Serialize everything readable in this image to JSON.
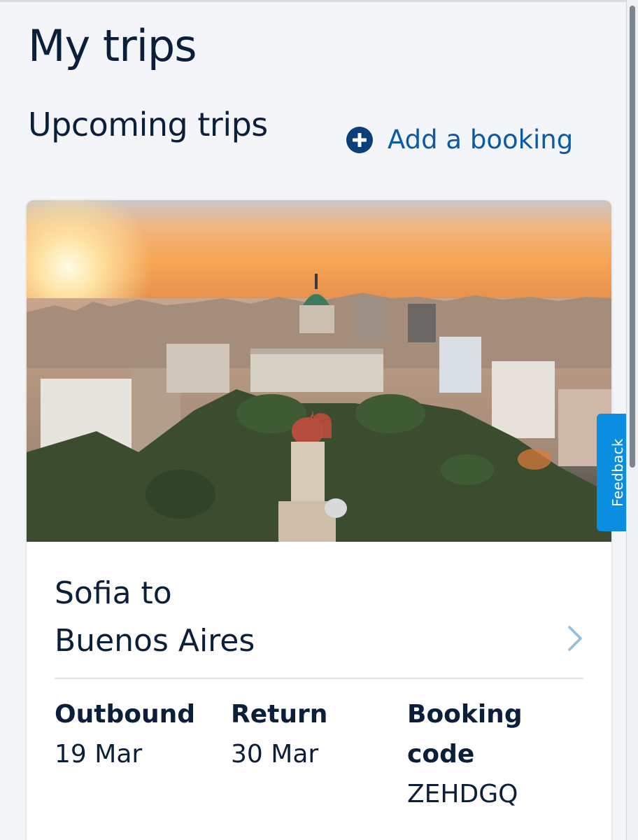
{
  "header": {
    "title": "My trips"
  },
  "upcoming": {
    "section_title": "Upcoming trips",
    "add_booking_label": "Add a booking",
    "add_booking_icon": "plus-circle-icon",
    "accent_color": "#0b5aa8"
  },
  "trip": {
    "image_alt": "Buenos Aires cityscape at sunset",
    "route_line_1": "Sofia to",
    "route_line_2": "Buenos Aires",
    "outbound_label": "Outbound",
    "outbound_date": "19 Mar",
    "return_label": "Return",
    "return_date": "30 Mar",
    "booking_code_label": "Booking code",
    "booking_code": "ZEHDGQ",
    "chevron_icon": "chevron-right-icon"
  },
  "feedback": {
    "label": "Feedback",
    "color": "#0b8ee0"
  }
}
